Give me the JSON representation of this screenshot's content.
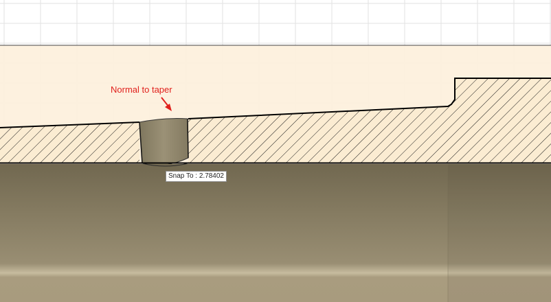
{
  "annotation": {
    "text": "Normal to taper",
    "color": "#e0201c"
  },
  "tooltip": {
    "text": "Snap To : 2.78402"
  },
  "colors": {
    "background": "#ffffff",
    "grid_line": "#e2e2e2",
    "sketch_band": "#fdf0dc",
    "section_fill": "#fbecd2",
    "hatch": "#1a1a1a",
    "outline": "#000000",
    "groove_face": "#948a6d",
    "cylinder_top": "#716850",
    "cylinder_bottom": "#aa9d80",
    "highlight": "#d2c7ac"
  }
}
